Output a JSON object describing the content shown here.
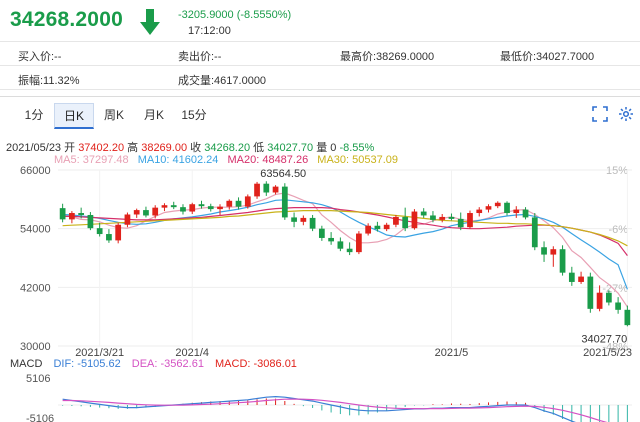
{
  "quote": {
    "price": "34268.2000",
    "change": "-3205.9000 (-8.5550%)",
    "time": "17:12:00",
    "colors": {
      "down": "#1a9c4a",
      "up": "#e0221b"
    }
  },
  "stats": {
    "bid": "买入价:--",
    "ask": "卖出价:--",
    "high": "最高价:38269.0000",
    "low": "最低价:34027.7000",
    "amplitude": "振幅:11.32%",
    "volume": "成交量:4617.0000"
  },
  "tabs": [
    {
      "label": "1分",
      "active": false
    },
    {
      "label": "日K",
      "active": true
    },
    {
      "label": "周K",
      "active": false
    },
    {
      "label": "月K",
      "active": false
    },
    {
      "label": "15分",
      "active": false
    }
  ],
  "toolbar": {
    "fullscreen_icon": "fullscreen-icon",
    "settings_icon": "settings-icon"
  },
  "ohlc": {
    "date": "2021/05/23",
    "open_label": "开",
    "open": "37402.20",
    "high_label": "高",
    "high": "38269.00",
    "close_label": "收",
    "close": "34268.20",
    "low_label": "低",
    "low": "34027.70",
    "vol_label": "量",
    "vol": "0",
    "pct": "-8.55%"
  },
  "ma": {
    "ma5": "MA5: 37297.48",
    "ma10": "MA10: 41602.24",
    "ma20": "MA20: 48487.26",
    "ma30": "MA30: 50537.09",
    "colors": {
      "ma5": "#e8a0b4",
      "ma10": "#3aa3e3",
      "ma20": "#d52f6a",
      "ma30": "#c9b219"
    }
  },
  "chart_data": {
    "type": "candlestick",
    "y_ticks": [
      "66000",
      "54000",
      "42000",
      "30000"
    ],
    "ylim": [
      30000,
      66000
    ],
    "x_ticks": [
      "2021/3/21",
      "2021/4",
      "2021/5",
      "2021/5/23"
    ],
    "right_pct_ticks": [
      "15%",
      "-6%",
      "-27%",
      "-48%"
    ],
    "annotations": {
      "max": "63564.50",
      "min": "34027.70"
    },
    "candles": [
      {
        "o": 58200,
        "h": 59100,
        "l": 55300,
        "c": 55900
      },
      {
        "o": 55900,
        "h": 57600,
        "l": 55100,
        "c": 57200
      },
      {
        "o": 57200,
        "h": 58300,
        "l": 56100,
        "c": 56800
      },
      {
        "o": 56800,
        "h": 57400,
        "l": 53700,
        "c": 54100
      },
      {
        "o": 54100,
        "h": 55200,
        "l": 52400,
        "c": 52900
      },
      {
        "o": 52900,
        "h": 53900,
        "l": 51100,
        "c": 51600
      },
      {
        "o": 51600,
        "h": 55200,
        "l": 51000,
        "c": 54800
      },
      {
        "o": 54800,
        "h": 57300,
        "l": 54300,
        "c": 56900
      },
      {
        "o": 56900,
        "h": 58100,
        "l": 56200,
        "c": 57800
      },
      {
        "o": 57800,
        "h": 58500,
        "l": 56300,
        "c": 56700
      },
      {
        "o": 56700,
        "h": 58800,
        "l": 56100,
        "c": 58300
      },
      {
        "o": 58300,
        "h": 59200,
        "l": 57600,
        "c": 58800
      },
      {
        "o": 58800,
        "h": 59500,
        "l": 58000,
        "c": 58400
      },
      {
        "o": 58400,
        "h": 59000,
        "l": 56900,
        "c": 57500
      },
      {
        "o": 57500,
        "h": 59300,
        "l": 57000,
        "c": 59000
      },
      {
        "o": 59000,
        "h": 59700,
        "l": 58100,
        "c": 58600
      },
      {
        "o": 58600,
        "h": 59100,
        "l": 57500,
        "c": 58000
      },
      {
        "o": 58000,
        "h": 59000,
        "l": 56800,
        "c": 58500
      },
      {
        "o": 58500,
        "h": 60000,
        "l": 57900,
        "c": 59700
      },
      {
        "o": 59700,
        "h": 60400,
        "l": 57900,
        "c": 58500
      },
      {
        "o": 58500,
        "h": 61000,
        "l": 58100,
        "c": 60600
      },
      {
        "o": 60600,
        "h": 63564.5,
        "l": 60100,
        "c": 63200
      },
      {
        "o": 63200,
        "h": 63700,
        "l": 60700,
        "c": 61400
      },
      {
        "o": 61400,
        "h": 62900,
        "l": 61000,
        "c": 62600
      },
      {
        "o": 62600,
        "h": 63300,
        "l": 55800,
        "c": 56300
      },
      {
        "o": 56300,
        "h": 57300,
        "l": 54300,
        "c": 55400
      },
      {
        "o": 55400,
        "h": 56700,
        "l": 54700,
        "c": 56200
      },
      {
        "o": 56200,
        "h": 56800,
        "l": 53500,
        "c": 54000
      },
      {
        "o": 54000,
        "h": 54600,
        "l": 51500,
        "c": 52100
      },
      {
        "o": 52100,
        "h": 53300,
        "l": 50700,
        "c": 51400
      },
      {
        "o": 51400,
        "h": 52200,
        "l": 49400,
        "c": 49900
      },
      {
        "o": 49900,
        "h": 51200,
        "l": 48600,
        "c": 49200
      },
      {
        "o": 49200,
        "h": 53500,
        "l": 48800,
        "c": 53000
      },
      {
        "o": 53000,
        "h": 55100,
        "l": 52600,
        "c": 54600
      },
      {
        "o": 54600,
        "h": 55400,
        "l": 53400,
        "c": 53900
      },
      {
        "o": 53900,
        "h": 55200,
        "l": 53500,
        "c": 54800
      },
      {
        "o": 54800,
        "h": 56800,
        "l": 54300,
        "c": 56400
      },
      {
        "o": 56400,
        "h": 58300,
        "l": 53500,
        "c": 54100
      },
      {
        "o": 54100,
        "h": 58000,
        "l": 53800,
        "c": 57500
      },
      {
        "o": 57500,
        "h": 58200,
        "l": 56200,
        "c": 56700
      },
      {
        "o": 56700,
        "h": 57600,
        "l": 55300,
        "c": 55800
      },
      {
        "o": 55800,
        "h": 57000,
        "l": 55300,
        "c": 56400
      },
      {
        "o": 56400,
        "h": 57100,
        "l": 55700,
        "c": 56000
      },
      {
        "o": 56000,
        "h": 57300,
        "l": 53700,
        "c": 54300
      },
      {
        "o": 54300,
        "h": 57700,
        "l": 54000,
        "c": 57200
      },
      {
        "o": 57200,
        "h": 58400,
        "l": 56500,
        "c": 57900
      },
      {
        "o": 57900,
        "h": 59000,
        "l": 57300,
        "c": 58600
      },
      {
        "o": 58600,
        "h": 59600,
        "l": 58200,
        "c": 59300
      },
      {
        "o": 59300,
        "h": 59600,
        "l": 56700,
        "c": 57200
      },
      {
        "o": 57200,
        "h": 58600,
        "l": 56200,
        "c": 57900
      },
      {
        "o": 57900,
        "h": 58400,
        "l": 55900,
        "c": 56300
      },
      {
        "o": 56300,
        "h": 57200,
        "l": 49600,
        "c": 50200
      },
      {
        "o": 50200,
        "h": 51400,
        "l": 47200,
        "c": 48700
      },
      {
        "o": 48700,
        "h": 50400,
        "l": 46200,
        "c": 49800
      },
      {
        "o": 49800,
        "h": 50600,
        "l": 44400,
        "c": 45000
      },
      {
        "o": 45000,
        "h": 46200,
        "l": 42300,
        "c": 43100
      },
      {
        "o": 43100,
        "h": 45200,
        "l": 42700,
        "c": 44200
      },
      {
        "o": 44200,
        "h": 45000,
        "l": 36800,
        "c": 37600
      },
      {
        "o": 37600,
        "h": 42400,
        "l": 37100,
        "c": 40900
      },
      {
        "o": 40900,
        "h": 41400,
        "l": 38300,
        "c": 38900
      },
      {
        "o": 38900,
        "h": 40000,
        "l": 36600,
        "c": 37400
      },
      {
        "o": 37402.2,
        "h": 38269,
        "l": 34027.7,
        "c": 34268.2
      }
    ],
    "series": [
      {
        "name": "MA5",
        "color": "#e8a0b4",
        "values": [
          56800,
          56400,
          55900,
          55800,
          55400,
          54700,
          54200,
          54100,
          54600,
          55600,
          56500,
          57300,
          57600,
          57800,
          57900,
          58200,
          58400,
          58400,
          58400,
          58500,
          58800,
          59500,
          60100,
          61000,
          61300,
          60600,
          59800,
          59100,
          56800,
          55300,
          53600,
          52200,
          51100,
          51100,
          51300,
          51800,
          52700,
          54200,
          54800,
          54900,
          55600,
          56100,
          56400,
          55900,
          55600,
          55700,
          56200,
          57000,
          57400,
          57800,
          57900,
          56900,
          55600,
          54200,
          52200,
          49500,
          48100,
          46100,
          44000,
          42600,
          40800,
          38000
        ]
      },
      {
        "name": "MA10",
        "color": "#3aa3e3",
        "values": [
          56900,
          56800,
          56600,
          56400,
          56100,
          55700,
          55300,
          55000,
          54900,
          55000,
          55300,
          55700,
          56000,
          56200,
          56400,
          56700,
          57000,
          57400,
          57700,
          58000,
          58400,
          58900,
          59300,
          59800,
          59900,
          59700,
          59500,
          59300,
          58900,
          58300,
          57400,
          56300,
          55300,
          54400,
          53600,
          52700,
          52400,
          52300,
          52700,
          53100,
          53400,
          53900,
          54600,
          55000,
          55300,
          55700,
          56000,
          56300,
          56600,
          56800,
          56900,
          56500,
          56000,
          55300,
          54300,
          53000,
          51700,
          50500,
          49200,
          47800,
          46600,
          41600
        ]
      },
      {
        "name": "MA20",
        "color": "#d52f6a",
        "values": [
          56500,
          56500,
          56400,
          56300,
          56200,
          56100,
          56000,
          55900,
          55800,
          55800,
          55800,
          55900,
          56000,
          56100,
          56200,
          56300,
          56500,
          56700,
          56900,
          57100,
          57300,
          57600,
          57900,
          58100,
          58200,
          58300,
          58300,
          58300,
          58300,
          58200,
          57900,
          57700,
          57400,
          57100,
          56800,
          56400,
          56000,
          55600,
          55300,
          55000,
          54700,
          54400,
          54200,
          54100,
          54000,
          54000,
          54100,
          54200,
          54300,
          54500,
          54600,
          54700,
          54700,
          54600,
          54400,
          54100,
          53700,
          53300,
          52700,
          51900,
          51000,
          48500
        ]
      },
      {
        "name": "MA30",
        "color": "#c9b219",
        "values": [
          54600,
          54700,
          54800,
          54900,
          55000,
          55100,
          55200,
          55300,
          55400,
          55500,
          55600,
          55700,
          55800,
          55900,
          56000,
          56100,
          56200,
          56300,
          56500,
          56600,
          56800,
          57000,
          57200,
          57400,
          57500,
          57600,
          57700,
          57700,
          57700,
          57700,
          57600,
          57500,
          57400,
          57300,
          57100,
          56900,
          56700,
          56500,
          56300,
          56100,
          55900,
          55700,
          55600,
          55500,
          55400,
          55300,
          55200,
          55100,
          55100,
          55000,
          55000,
          54900,
          54800,
          54600,
          54400,
          54100,
          53700,
          53300,
          52800,
          52200,
          51500,
          50500
        ]
      }
    ],
    "macd": {
      "label": "MACD",
      "dif": "DIF: -5105.62",
      "dea": "DEA: -3562.61",
      "macd": "MACD: -3086.01",
      "y_ticks": [
        "5106",
        "-5106"
      ],
      "colors": {
        "dif": "#3a7fd5",
        "dea": "#d452c3",
        "macd": "#e0221b"
      },
      "dif_values": [
        900,
        700,
        500,
        300,
        100,
        -100,
        -300,
        -400,
        -400,
        -300,
        -200,
        -100,
        0,
        100,
        200,
        300,
        400,
        500,
        600,
        700,
        800,
        1000,
        1200,
        1300,
        1200,
        1000,
        800,
        600,
        300,
        0,
        -300,
        -600,
        -800,
        -900,
        -900,
        -900,
        -800,
        -700,
        -600,
        -600,
        -500,
        -500,
        -400,
        -400,
        -400,
        -300,
        -200,
        -100,
        0,
        0,
        0,
        -400,
        -900,
        -1300,
        -1900,
        -2500,
        -3000,
        -3600,
        -4100,
        -4500,
        -4800,
        -5106
      ],
      "dea_values": [
        700,
        700,
        650,
        580,
        500,
        400,
        300,
        200,
        100,
        30,
        -10,
        -30,
        -30,
        -10,
        20,
        70,
        130,
        200,
        280,
        360,
        450,
        560,
        690,
        810,
        890,
        910,
        890,
        830,
        720,
        580,
        400,
        200,
        0,
        -180,
        -320,
        -440,
        -510,
        -550,
        -560,
        -570,
        -560,
        -550,
        -520,
        -500,
        -480,
        -450,
        -400,
        -340,
        -270,
        -220,
        -170,
        -220,
        -360,
        -550,
        -820,
        -1150,
        -1520,
        -1940,
        -2380,
        -2800,
        -3200,
        -3563
      ],
      "hist_values": [
        -100,
        -150,
        -200,
        -300,
        -400,
        -500,
        -600,
        -600,
        -500,
        -400,
        -300,
        -150,
        50,
        200,
        350,
        450,
        550,
        600,
        650,
        700,
        700,
        880,
        1020,
        980,
        620,
        180,
        -180,
        -460,
        -840,
        -1160,
        -1400,
        -1600,
        -1600,
        -1440,
        -1160,
        -920,
        -580,
        -300,
        -80,
        -60,
        120,
        100,
        240,
        200,
        160,
        300,
        400,
        480,
        540,
        440,
        340,
        -360,
        -1080,
        -1500,
        -2160,
        -2700,
        -2960,
        -3320,
        -3440,
        -3400,
        -3200,
        -3086
      ]
    }
  }
}
